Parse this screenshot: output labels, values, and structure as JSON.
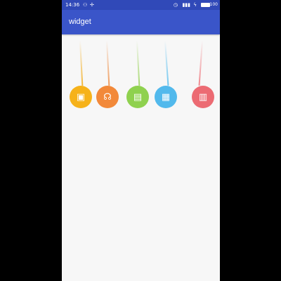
{
  "status": {
    "time": "14:36",
    "battery": "100"
  },
  "app_bar": {
    "title": "widget"
  },
  "pendulums": [
    {
      "name": "book-icon",
      "color": "#f6b21a",
      "string_color": "#f3b73a",
      "glyph": "▣"
    },
    {
      "name": "headset-icon",
      "color": "#f2893a",
      "string_color": "#ef9a5a",
      "glyph": "☊"
    },
    {
      "name": "gift-icon",
      "color": "#8fd14f",
      "string_color": "#a6d86f",
      "glyph": "▤"
    },
    {
      "name": "bus-icon",
      "color": "#52b9ec",
      "string_color": "#6ec6f0",
      "glyph": "▦"
    },
    {
      "name": "chart-icon",
      "color": "#ec6b73",
      "string_color": "#ef868c",
      "glyph": "▥"
    }
  ]
}
